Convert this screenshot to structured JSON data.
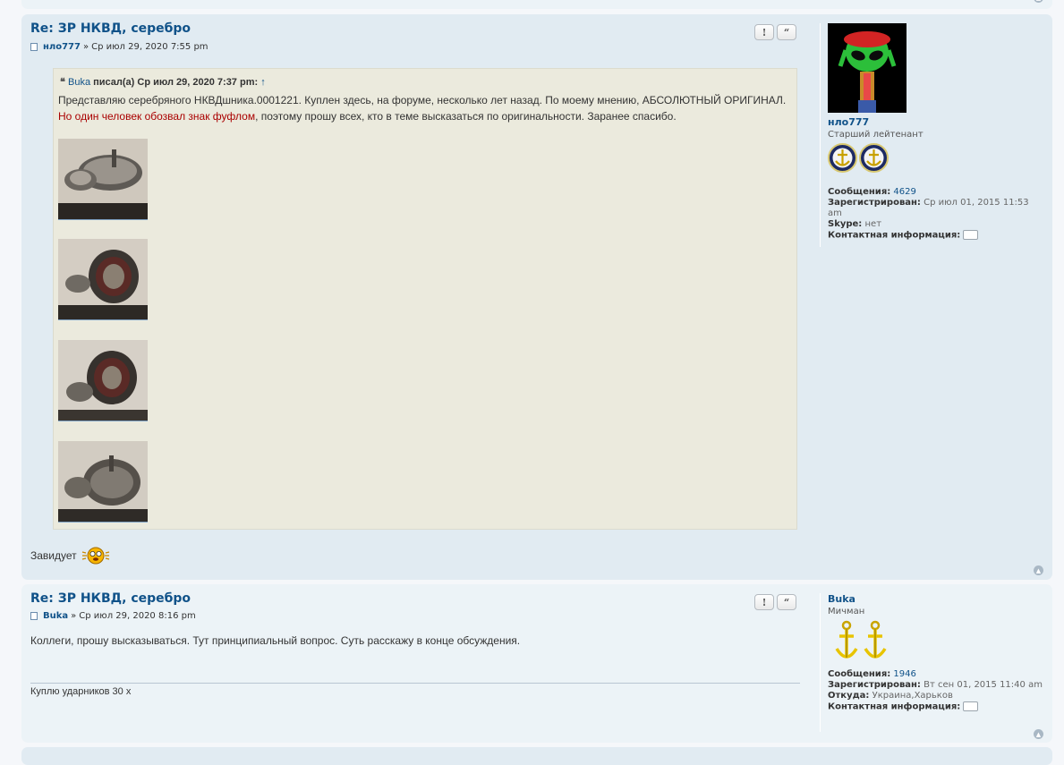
{
  "posts": [
    {
      "title": "Re: ЗР НКВД, серебро",
      "author": "нло777",
      "separator": "»",
      "date": "Ср июл 29, 2020 7:55 pm",
      "buttons": {
        "report": "!",
        "quote": "“"
      },
      "quote": {
        "author": "Buka",
        "wrote": "писал(а) Ср июл 29, 2020 7:37 pm:",
        "arrow": "↑",
        "line1": "Представляю серебряного НКВДшника.0001221. Куплен здесь, на форуме, несколько лет назад. По моему мнению, АБСОЛЮТНЫЙ ОРИГИНАЛ.",
        "line2_red": "Но один человек обозвал знак фуфлом",
        "line2_rest": ", поэтому прошу всех, кто в теме высказаться по оригинальности. Заранее спасибо."
      },
      "text": "Завидует",
      "profile": {
        "username": "нло777",
        "rank": "Старший лейтенант",
        "posts_label": "Сообщения:",
        "posts_value": "4629",
        "joined_label": "Зарегистрирован:",
        "joined_value": "Ср июл 01, 2015 11:53 am",
        "skype_label": "Skype:",
        "skype_value": "нет",
        "contact_label": "Контактная информация:"
      }
    },
    {
      "title": "Re: ЗР НКВД, серебро",
      "author": "Buka",
      "separator": "»",
      "date": "Ср июл 29, 2020 8:16 pm",
      "buttons": {
        "report": "!",
        "quote": "“"
      },
      "text": "Коллеги, прошу высказываться. Тут принципиальный вопрос. Суть расскажу в конце обсуждения.",
      "signature": "Куплю ударников 30 х",
      "profile": {
        "username": "Buka",
        "rank": "Мичман",
        "posts_label": "Сообщения:",
        "posts_value": "1946",
        "joined_label": "Зарегистрирован:",
        "joined_value": "Вт сен 01, 2015 11:40 am",
        "from_label": "Откуда:",
        "from_value": "Украина,Харьков",
        "contact_label": "Контактная информация:"
      }
    }
  ],
  "icons": {
    "top": "▲"
  },
  "colors": {
    "post_bg1": "#e1ebf2",
    "post_bg2": "#ecf3f7",
    "link": "#105289",
    "quote_bg": "#ebeadd",
    "red_text": "#aa0000"
  }
}
